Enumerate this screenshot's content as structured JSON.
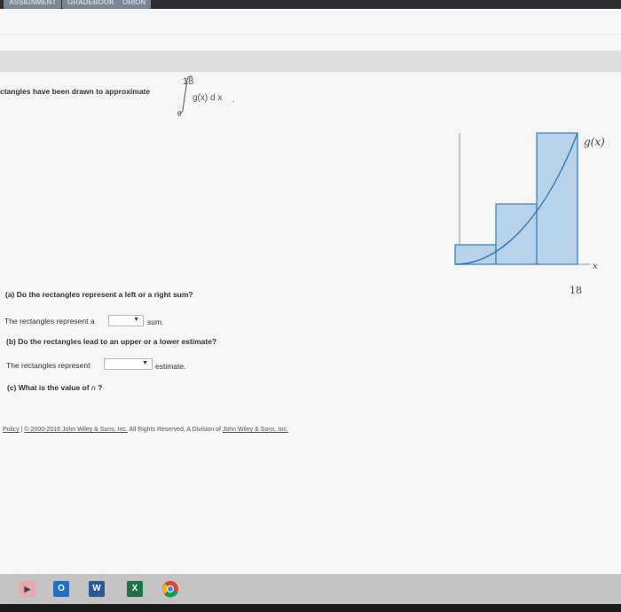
{
  "tabs": [
    "ASSIGNMENT",
    "GRADEBOOK",
    "ORION"
  ],
  "intro_text": "ctangles have been drawn to approximate",
  "integral": {
    "upper": "18",
    "lower": "0",
    "integrand": "g(x) d x",
    "period": "."
  },
  "graph": {
    "curve_label": "g(x)",
    "axis_label": "x",
    "tick_label": "18"
  },
  "questions": {
    "a_label": "(a)",
    "a_text": "Do the rectangles represent a left or a right sum?",
    "a_prefix": "The rectangles represent a",
    "a_suffix": "sum.",
    "b_label": "(b)",
    "b_text": "Do the rectangles lead to an upper or a lower estimate?",
    "b_prefix": "The rectangles represent",
    "b_suffix": "estimate.",
    "c_label": "(c)",
    "c_text": "What is the value of",
    "c_var": "n",
    "c_end": "?"
  },
  "footer": {
    "policy": "Policy",
    "sep": "|",
    "copyright": "© 2000-2016 John Wiley & Sons, Inc.",
    "rights": "All Rights Reserved. A Division of",
    "company": "John Wiley & Sons, Inc."
  },
  "taskbar": {
    "apps": [
      "O",
      "W",
      "X"
    ]
  },
  "colors": {
    "rect_fill": "#b7d3ea",
    "rect_stroke": "#3a84c4",
    "curve": "#2f6fae"
  }
}
